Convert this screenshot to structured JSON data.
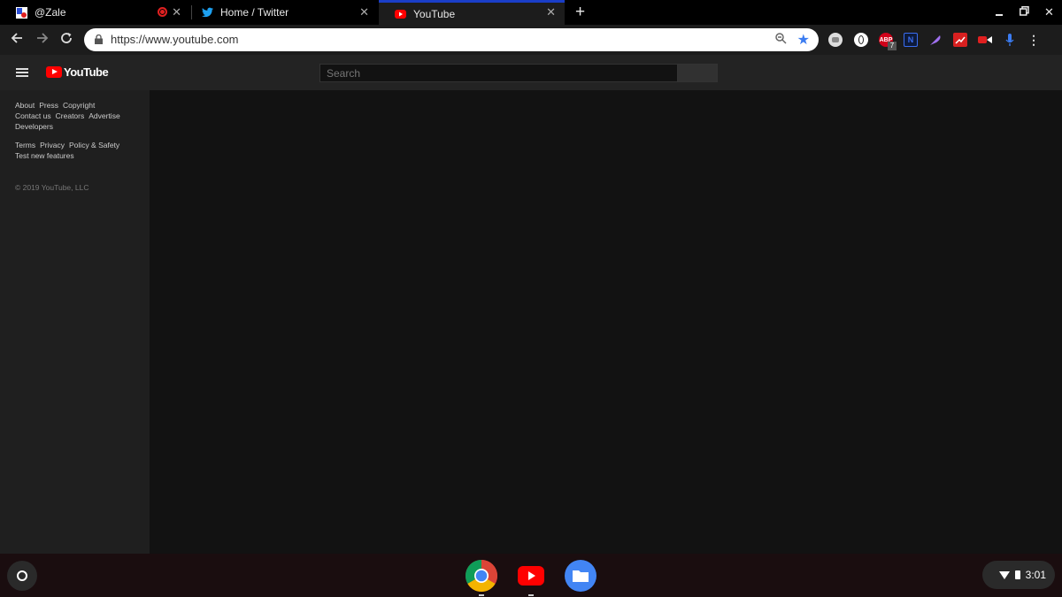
{
  "tabs": [
    {
      "title": "@Zale",
      "icon": "profile-favicon-icon"
    },
    {
      "title": "Home / Twitter",
      "icon": "twitter-bird-icon"
    },
    {
      "title": "YouTube",
      "icon": "youtube-favicon-icon",
      "active": true
    }
  ],
  "omnibox": {
    "url": "https://www.youtube.com"
  },
  "extensions": {
    "abp_badge": "7",
    "abp_label": "ABP",
    "n_label": "N"
  },
  "youtube": {
    "logo_text": "YouTube",
    "search_placeholder": "Search",
    "footer": {
      "row1": [
        "About",
        "Press",
        "Copyright"
      ],
      "row2": [
        "Contact us",
        "Creators",
        "Advertise"
      ],
      "row3": [
        "Developers"
      ],
      "row4": [
        "Terms",
        "Privacy",
        "Policy & Safety"
      ],
      "row5": [
        "Test new features"
      ],
      "copyright": "© 2019 YouTube, LLC"
    }
  },
  "shelf": {
    "time": "3:01"
  },
  "colors": {
    "accent": "#1a3ec8",
    "youtube_red": "#ff0000",
    "star": "#3b7cf1"
  }
}
